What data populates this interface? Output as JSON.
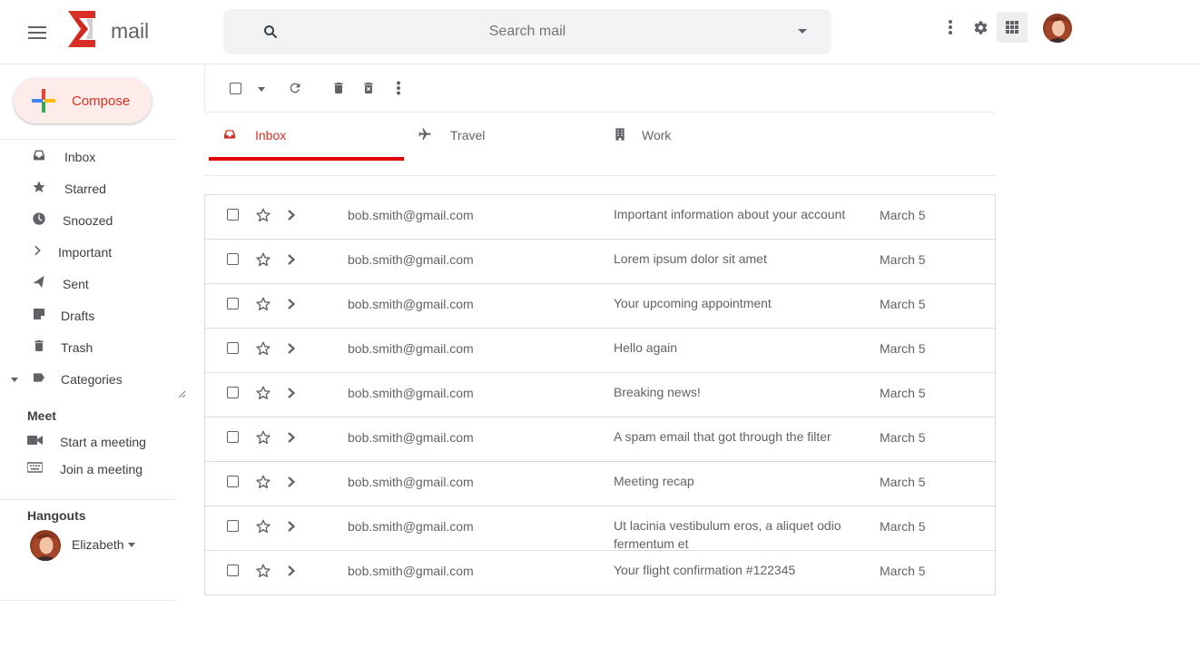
{
  "app": {
    "logo_text": "mail",
    "brand_color": "#d93025",
    "accent_underline_color": "#e00000"
  },
  "search": {
    "placeholder": "Search mail",
    "value": ""
  },
  "compose": {
    "label": "Compose"
  },
  "sidebar": {
    "items": [
      {
        "label": "Inbox",
        "icon": "inbox-icon"
      },
      {
        "label": "Starred",
        "icon": "star-icon"
      },
      {
        "label": "Snoozed",
        "icon": "clock-icon"
      },
      {
        "label": "Important",
        "icon": "chevron-right-icon"
      },
      {
        "label": "Sent",
        "icon": "send-icon"
      },
      {
        "label": "Drafts",
        "icon": "draft-icon"
      },
      {
        "label": "Trash",
        "icon": "trash-icon"
      },
      {
        "label": "Categories",
        "icon": "label-icon"
      }
    ]
  },
  "meet": {
    "title": "Meet",
    "items": [
      {
        "label": "Start a meeting",
        "icon": "videocam-icon"
      },
      {
        "label": "Join a meeting",
        "icon": "keyboard-icon"
      }
    ]
  },
  "hangouts": {
    "title": "Hangouts",
    "user": "Elizabeth"
  },
  "tabs": [
    {
      "label": "Inbox",
      "icon": "inbox-icon",
      "active": true
    },
    {
      "label": "Travel",
      "icon": "airplane-icon",
      "active": false
    },
    {
      "label": "Work",
      "icon": "building-icon",
      "active": false
    }
  ],
  "emails": [
    {
      "sender": "bob.smith@gmail.com",
      "subject": "Important information about your account",
      "date": "March 5"
    },
    {
      "sender": "bob.smith@gmail.com",
      "subject": "Lorem ipsum dolor sit amet",
      "date": "March 5"
    },
    {
      "sender": "bob.smith@gmail.com",
      "subject": "Your upcoming appointment",
      "date": "March 5"
    },
    {
      "sender": "bob.smith@gmail.com",
      "subject": "Hello again",
      "date": "March 5"
    },
    {
      "sender": "bob.smith@gmail.com",
      "subject": "Breaking news!",
      "date": "March 5"
    },
    {
      "sender": "bob.smith@gmail.com",
      "subject": "A spam email that got through the filter",
      "date": "March 5"
    },
    {
      "sender": "bob.smith@gmail.com",
      "subject": "Meeting recap",
      "date": "March 5"
    },
    {
      "sender": "bob.smith@gmail.com",
      "subject": "Ut lacinia vestibulum eros, a aliquet odio fermentum et",
      "date": "March 5"
    },
    {
      "sender": "bob.smith@gmail.com",
      "subject": "Your flight confirmation #122345",
      "date": "March 5"
    }
  ]
}
